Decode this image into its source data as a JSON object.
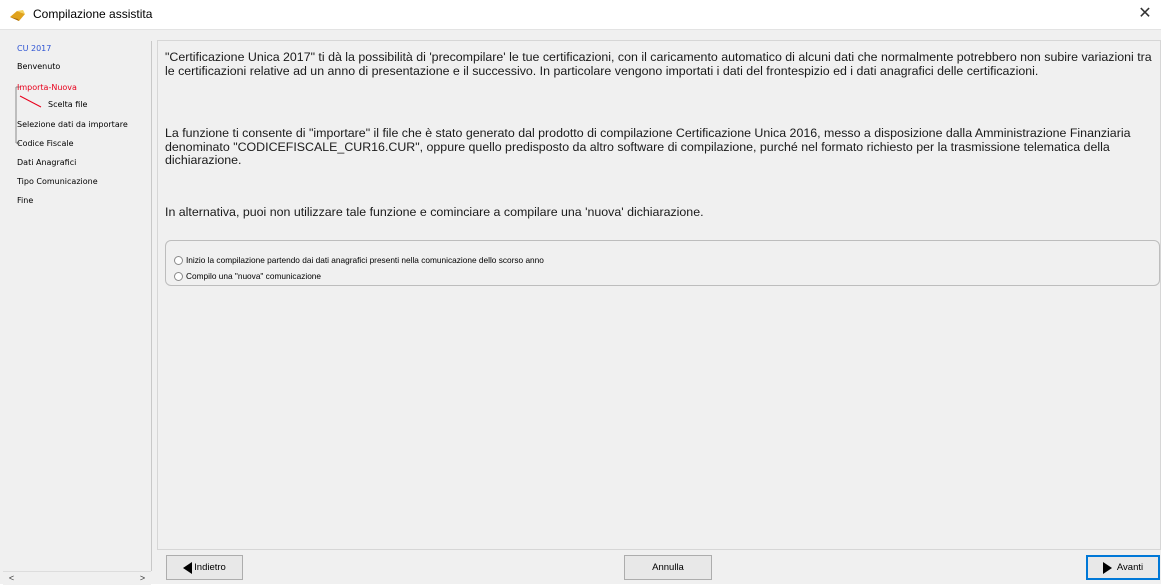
{
  "window": {
    "title": "Compilazione assistita",
    "close_symbol": "✕"
  },
  "tree": {
    "items": [
      {
        "label": "CU 2017",
        "state": "active"
      },
      {
        "label": "Benvenuto",
        "state": "normal"
      },
      {
        "label": "Importa-Nuova",
        "state": "current"
      },
      {
        "label": "Scelta file",
        "state": "normal"
      },
      {
        "label": "Selezione dati da importare",
        "state": "normal"
      },
      {
        "label": "Codice Fiscale",
        "state": "normal"
      },
      {
        "label": "Dati Anagrafici",
        "state": "normal"
      },
      {
        "label": "Tipo Comunicazione",
        "state": "normal"
      },
      {
        "label": "Fine",
        "state": "normal"
      }
    ],
    "scroll_left": "<",
    "scroll_right": ">"
  },
  "content": {
    "paragraph1": "\"Certificazione Unica 2017\" ti dà la possibilità di 'precompilare' le tue certificazioni, con il caricamento automatico di alcuni dati che normalmente potrebbero non subire variazioni tra le certificazioni relative ad un anno di presentazione e il successivo. In particolare vengono importati i dati del frontespizio ed i dati anagrafici delle certificazioni.",
    "paragraph2": "La funzione ti consente di \"importare\" il file che è stato generato dal prodotto di compilazione Certificazione Unica 2016, messo a disposizione dalla Amministrazione Finanziaria denominato \"CODICEFISCALE_CUR16.CUR\", oppure quello predisposto da altro software di compilazione, purché nel formato richiesto per la trasmissione telematica della dichiarazione.",
    "paragraph3": "In alternativa, puoi non utilizzare tale funzione e cominciare a compilare una 'nuova' dichiarazione.",
    "options": [
      {
        "label": "Inizio la compilazione partendo dai dati anagrafici presenti nella comunicazione dello scorso anno",
        "selected": false
      },
      {
        "label": "Compilo una \"nuova\" comunicazione",
        "selected": false
      }
    ]
  },
  "buttons": {
    "back": "Indietro",
    "cancel": "Annulla",
    "next": "Avanti"
  },
  "colors": {
    "active_item": "#2f55d4",
    "current_item": "#e8001c",
    "default_button_border": "#0078d7"
  }
}
